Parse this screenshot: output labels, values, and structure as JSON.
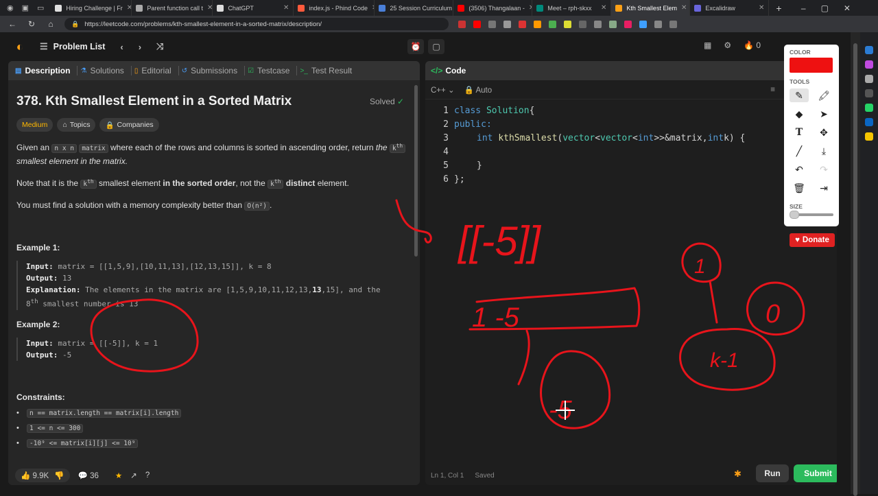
{
  "browser": {
    "tabs": [
      {
        "label": "Hiring Challenge | Fr",
        "color": "#e0e0e0"
      },
      {
        "label": "Parent function call t",
        "color": "#aaaaaa"
      },
      {
        "label": "ChatGPT",
        "color": "#dddddd"
      },
      {
        "label": "index.js - Phind Code",
        "color": "#ff5a3c"
      },
      {
        "label": "25 Session Curriculum",
        "color": "#4a7fd8"
      },
      {
        "label": "(3506) Thangalaan -",
        "color": "#ff0000"
      },
      {
        "label": "Meet – rph-skxx",
        "color": "#00897b"
      },
      {
        "label": "Kth Smallest Elem",
        "color": "#ffa116"
      },
      {
        "label": "Excalidraw",
        "color": "#6965db"
      }
    ],
    "url": "https://leetcode.com/problems/kth-smallest-element-in-a-sorted-matrix/description/"
  },
  "header": {
    "problem_list": "Problem List",
    "streak": "0"
  },
  "left_tabs": [
    "Description",
    "Solutions",
    "Editorial",
    "Submissions",
    "Testcase",
    "Test Result"
  ],
  "problem": {
    "title": "378. Kth Smallest Element in a Sorted Matrix",
    "status": "Solved",
    "difficulty": "Medium",
    "topics": "Topics",
    "companies": "Companies",
    "p1_a": "Given an",
    "p1_code1": "n x n",
    "p1_code2": "matrix",
    "p1_b": "where each of the rows and columns is sorted in ascending order, return",
    "p1_c": "the",
    "p1_k": "k",
    "p1_th": "th",
    "p1_d": "smallest element in the matrix.",
    "p2_a": "Note that it is the",
    "p2_b": "smallest element",
    "p2_bold1": "in the sorted order",
    "p2_c": ", not the",
    "p2_bold2": "distinct",
    "p2_d": "element.",
    "p3_a": "You must find a solution with a memory complexity better than",
    "p3_code": "O(n²)",
    "p3_b": "."
  },
  "example1": {
    "heading": "Example 1:",
    "input_label": "Input:",
    "input": "matrix = [[1,5,9],[10,11,13],[12,13,15]], k = 8",
    "output_label": "Output:",
    "output": "13",
    "explanation_label": "Explanation:",
    "explanation_a": "The elements in the matrix are [1,5,9,10,11,12,13,",
    "explanation_bold": "13",
    "explanation_b": ",15], and the",
    "explanation_c": "8",
    "explanation_d": "th",
    "explanation_e": "smallest number is 13"
  },
  "example2": {
    "heading": "Example 2:",
    "input_label": "Input:",
    "input": "matrix = [[-5]], k = 1",
    "output_label": "Output:",
    "output": "-5"
  },
  "constraints": {
    "heading": "Constraints:",
    "items": [
      "n == matrix.length == matrix[i].length",
      "1 <= n <= 300",
      "-10⁹ <= matrix[i][j] <= 10⁹"
    ]
  },
  "left_footer": {
    "likes": "9.9K",
    "comments": "36"
  },
  "code_panel": {
    "title": "Code",
    "language": "C++",
    "mode": "Auto",
    "status_pos": "Ln 1, Col 1",
    "status_saved": "Saved",
    "run": "Run",
    "submit": "Submit"
  },
  "code": {
    "l1_kw": "class",
    "l1_ty": "Solution",
    "l1_rest": " {",
    "l2": "public:",
    "l3_kw": "int",
    "l3_fn": "kthSmallest",
    "l3_a": "(",
    "l3_ty1": "vector",
    "l3_b": "<",
    "l3_ty2": "vector",
    "l3_c": "<",
    "l3_kw2": "int",
    "l3_d": ">>&",
    "l3_e": " matrix, ",
    "l3_kw3": "int",
    "l3_f": " k) {",
    "l5": "}",
    "l6": "};",
    "line_numbers": [
      "1",
      "2",
      "3",
      "4",
      "5",
      "6"
    ]
  },
  "palette": {
    "color_label": "COLOR",
    "color_value": "#ee1111",
    "tools_label": "TOOLS",
    "size_label": "SIZE",
    "tool_icons": [
      "pencil-icon",
      "highlighter-icon",
      "eraser-icon",
      "pointer-icon",
      "text-icon",
      "move-icon",
      "line-icon",
      "download-icon",
      "undo-icon",
      "redo-icon",
      "trash-icon",
      "exit-icon"
    ]
  },
  "donate": "Donate",
  "ink": {
    "text_matrix": "[[-5]]",
    "text_box": "1 -5",
    "text_circle1": "-5",
    "text_circle2": "1",
    "text_circle3": "0",
    "text_circle4": "k-1"
  }
}
